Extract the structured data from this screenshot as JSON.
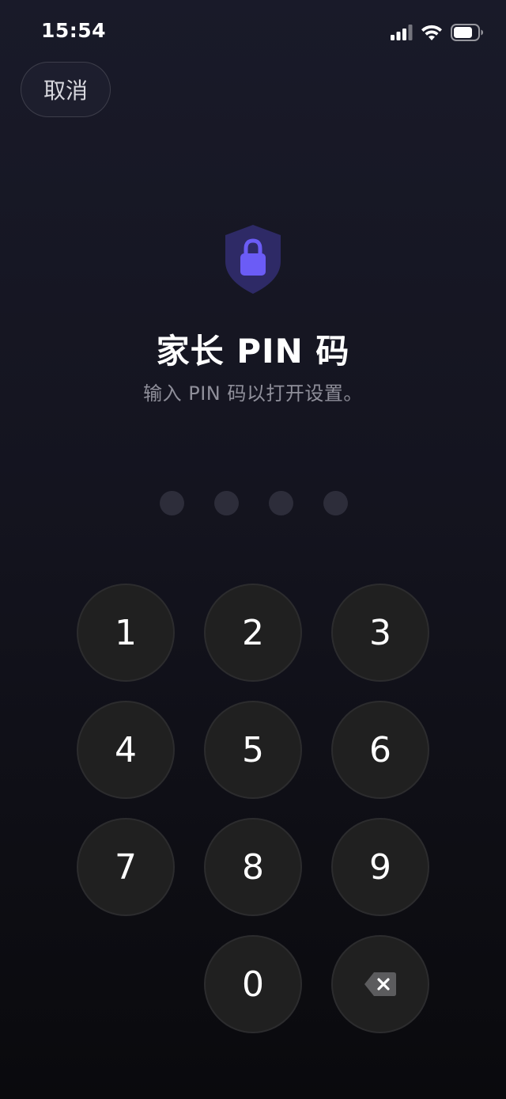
{
  "status_bar": {
    "time": "15:54",
    "icons": [
      "cellular-signal-icon",
      "wifi-icon",
      "battery-icon"
    ]
  },
  "header": {
    "cancel_label": "取消"
  },
  "main": {
    "icon": "shield-lock-icon",
    "title": "家长 PIN 码",
    "subtitle": "输入 PIN 码以打开设置。",
    "pin_length": 4,
    "pin_entered": 0
  },
  "keypad": {
    "keys": [
      "1",
      "2",
      "3",
      "4",
      "5",
      "6",
      "7",
      "8",
      "9",
      "0"
    ],
    "delete_icon": "backspace-icon"
  },
  "colors": {
    "accent": "#6b5cf6",
    "shield": "#2e2a66",
    "dot_empty": "#2d2d3a",
    "key_bg": "#202020"
  }
}
